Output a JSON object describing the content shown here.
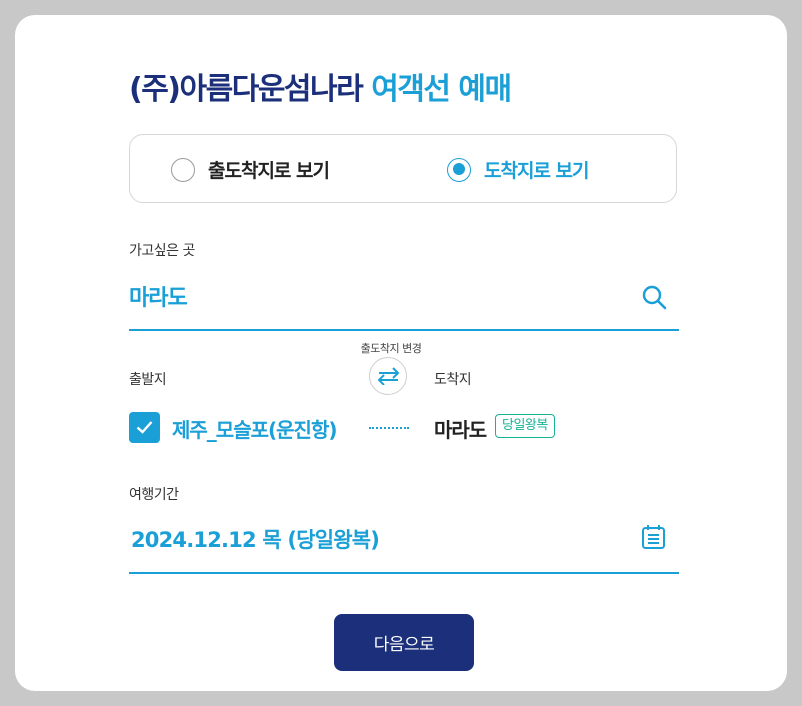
{
  "header": {
    "company": "(주)아름다운섬나라",
    "service": "여객선 예매"
  },
  "view_mode": {
    "options": [
      {
        "label": "출도착지로 보기",
        "selected": false
      },
      {
        "label": "도착지로 보기",
        "selected": true
      }
    ]
  },
  "destination": {
    "label": "가고싶은 곳",
    "value": "마라도",
    "icon": "search-icon"
  },
  "route": {
    "swap_caption": "출도착지 변경",
    "departure_label": "출발지",
    "arrival_label": "도착지",
    "departure_value": "제주_모슬포(운진항)",
    "departure_checked": true,
    "arrival_value": "마라도",
    "trip_badge": "당일왕복"
  },
  "period": {
    "label": "여행기간",
    "value": "2024.12.12 목 (당일왕복)",
    "icon": "calendar-icon"
  },
  "actions": {
    "next_label": "다음으로"
  },
  "colors": {
    "primary_navy": "#1b2f7a",
    "accent_blue": "#1a9fd6",
    "badge_green": "#17b394"
  }
}
